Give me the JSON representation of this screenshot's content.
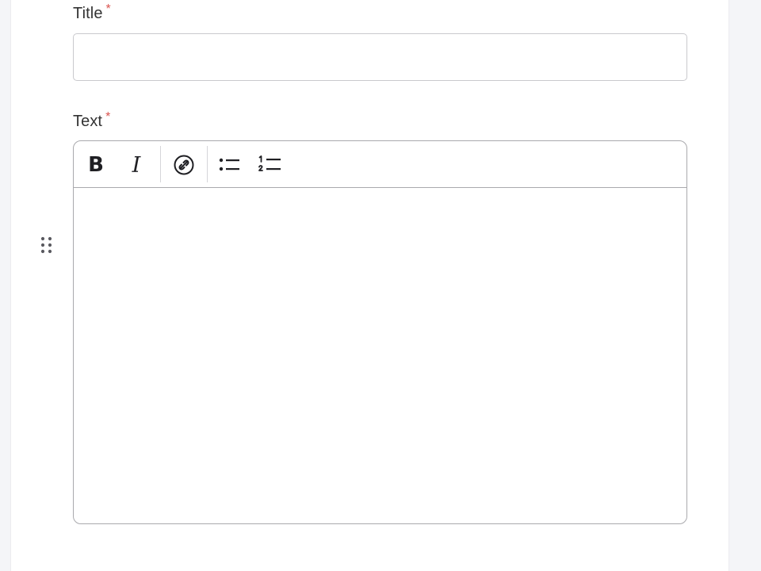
{
  "form": {
    "title_field": {
      "label": "Title",
      "required_marker": "*",
      "value": "",
      "placeholder": ""
    },
    "text_field": {
      "label": "Text",
      "required_marker": "*",
      "value": ""
    }
  },
  "toolbar": {
    "bold_label": "B",
    "italic_label": "I",
    "buttons": [
      "bold-icon",
      "italic-icon",
      "link-icon",
      "bullet-list-icon",
      "numbered-list-icon"
    ]
  },
  "colors": {
    "required": "#d9534f",
    "border": "#a9a9ad",
    "text": "#333333"
  }
}
